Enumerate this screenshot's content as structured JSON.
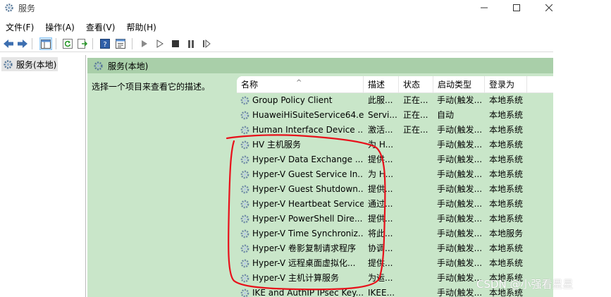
{
  "window": {
    "title": "服务"
  },
  "menu": {
    "items": [
      "文件(F)",
      "操作(A)",
      "查看(V)",
      "帮助(H)"
    ]
  },
  "tree": {
    "item_label": "服务(本地)"
  },
  "content": {
    "header": "服务(本地)",
    "description_prompt": "选择一个项目来查看它的描述。"
  },
  "table": {
    "columns": [
      "名称",
      "描述",
      "状态",
      "启动类型",
      "登录为"
    ],
    "rows": [
      {
        "name": "Group Policy Client",
        "desc": "此服...",
        "status": "正在...",
        "startup": "手动(触发...",
        "logon": "本地系统"
      },
      {
        "name": "HuaweiHiSuiteService64.e...",
        "desc": "Servi...",
        "status": "正在...",
        "startup": "自动",
        "logon": "本地系统"
      },
      {
        "name": "Human Interface Device ...",
        "desc": "激活...",
        "status": "正在...",
        "startup": "手动(触发...",
        "logon": "本地系统"
      },
      {
        "name": "HV 主机服务",
        "desc": "为 H...",
        "status": "",
        "startup": "手动(触发...",
        "logon": "本地系统"
      },
      {
        "name": "Hyper-V Data Exchange ...",
        "desc": "提供...",
        "status": "",
        "startup": "手动(触发...",
        "logon": "本地系统"
      },
      {
        "name": "Hyper-V Guest Service In...",
        "desc": "为 H...",
        "status": "",
        "startup": "手动(触发...",
        "logon": "本地系统"
      },
      {
        "name": "Hyper-V Guest Shutdown...",
        "desc": "提供...",
        "status": "",
        "startup": "手动(触发...",
        "logon": "本地系统"
      },
      {
        "name": "Hyper-V Heartbeat Service",
        "desc": "通过...",
        "status": "",
        "startup": "手动(触发...",
        "logon": "本地系统"
      },
      {
        "name": "Hyper-V PowerShell Dire...",
        "desc": "提供...",
        "status": "",
        "startup": "手动(触发...",
        "logon": "本地系统"
      },
      {
        "name": "Hyper-V Time Synchroniz...",
        "desc": "将此...",
        "status": "",
        "startup": "手动(触发...",
        "logon": "本地服务"
      },
      {
        "name": "Hyper-V 卷影复制请求程序",
        "desc": "协调...",
        "status": "",
        "startup": "手动(触发...",
        "logon": "本地系统"
      },
      {
        "name": "Hyper-V 远程桌面虚拟化...",
        "desc": "提供...",
        "status": "",
        "startup": "手动(触发...",
        "logon": "本地系统"
      },
      {
        "name": "Hyper-V 主机计算服务",
        "desc": "为运...",
        "status": "",
        "startup": "手动(触发...",
        "logon": "本地系统"
      },
      {
        "name": "IKE and AuthIP IPsec Key...",
        "desc": "IKEE...",
        "status": "",
        "startup": "手动(触发...",
        "logon": "本地系统"
      }
    ]
  },
  "watermark": "CSDN @小强看星星",
  "colors": {
    "pane_bg": "#c9e6c9",
    "header_bg": "#a9cfa9",
    "annotation": "#e8101a"
  }
}
